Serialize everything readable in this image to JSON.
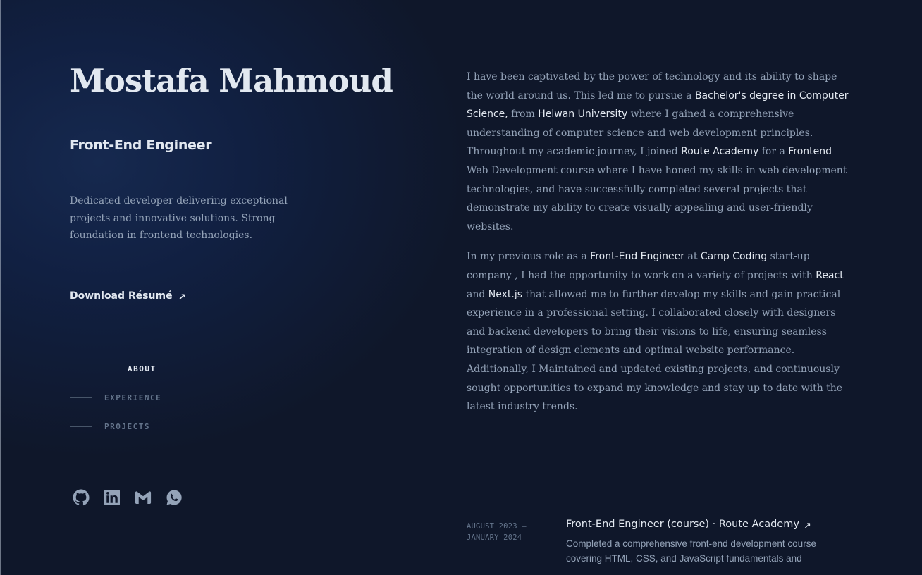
{
  "header": {
    "name": "Mostafa Mahmoud",
    "role": "Front-End Engineer",
    "tagline": "Dedicated developer delivering exceptional projects and innovative solutions. Strong foundation in frontend technologies.",
    "resume_label": "Download Résumé",
    "arrow": "↗"
  },
  "nav": {
    "items": [
      {
        "label": "ABOUT",
        "active": true
      },
      {
        "label": "EXPERIENCE",
        "active": false
      },
      {
        "label": "PROJECTS",
        "active": false
      }
    ]
  },
  "socials": [
    "github-icon",
    "linkedin-icon",
    "gmail-icon",
    "whatsapp-icon"
  ],
  "about": {
    "p1": [
      {
        "t": "I have been captivated by the power of technology and its ability to shape the world around us. This led me to pursue a "
      },
      {
        "t": "Bachelor's degree in Computer Science,",
        "h": true
      },
      {
        "t": " from "
      },
      {
        "t": "Helwan University",
        "h": true
      },
      {
        "t": " where I gained a comprehensive understanding of computer science and web development principles. Throughout my academic journey, I joined "
      },
      {
        "t": "Route Academy",
        "h": true
      },
      {
        "t": " for a "
      },
      {
        "t": "Frontend",
        "h": true
      },
      {
        "t": " Web Development course where I have honed my skills in web development technologies, and have successfully completed several projects that demonstrate my ability to create visually appealing and user-friendly websites."
      }
    ],
    "p2": [
      {
        "t": "In my previous role as a "
      },
      {
        "t": "Front-End Engineer",
        "h": true
      },
      {
        "t": " at "
      },
      {
        "t": "Camp Coding",
        "h": true
      },
      {
        "t": " start-up company , I had the opportunity to work on a variety of projects with "
      },
      {
        "t": "React",
        "h": true
      },
      {
        "t": " and "
      },
      {
        "t": "Next.js",
        "h": true
      },
      {
        "t": " that allowed me to further develop my skills and gain practical experience in a professional setting. I collaborated closely with designers and backend developers to bring their visions to life, ensuring seamless integration of design elements and optimal website performance. Additionally, I Maintained and updated existing projects, and continuously sought opportunities to expand my knowledge and stay up to date with the latest industry trends."
      }
    ]
  },
  "experience": {
    "date_line1": "AUGUST 2023 —",
    "date_line2": "JANUARY 2024",
    "title": "Front-End Engineer (course) · Route Academy",
    "description": "Completed a comprehensive front-end development course covering HTML, CSS, and JavaScript fundamentals and"
  },
  "colors": {
    "background": "#0f172a",
    "text_primary": "#e2e8f0",
    "text_secondary": "#94a3b8",
    "text_muted": "#64748b"
  }
}
